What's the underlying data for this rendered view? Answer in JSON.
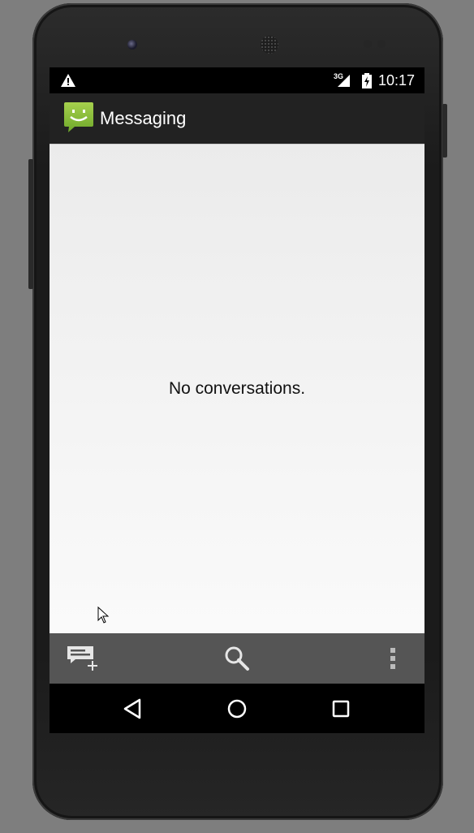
{
  "status_bar": {
    "warning_icon": "warning-icon",
    "network_type": "3G",
    "signal_icon": "cell-signal-icon",
    "battery_icon": "battery-charging-icon",
    "time": "10:17"
  },
  "action_bar": {
    "app_icon": "messaging-smiley-icon",
    "title": "Messaging",
    "background": "#222222",
    "accent": "#8dc63f"
  },
  "content": {
    "empty_message": "No conversations."
  },
  "bottom_bar": {
    "actions": [
      {
        "name": "new-message",
        "icon": "compose-icon"
      },
      {
        "name": "search",
        "icon": "search-icon"
      },
      {
        "name": "more-options",
        "icon": "overflow-menu-icon"
      }
    ],
    "background": "#555555"
  },
  "nav_bar": {
    "buttons": [
      {
        "name": "back",
        "icon": "back-triangle-icon"
      },
      {
        "name": "home",
        "icon": "home-circle-icon"
      },
      {
        "name": "recents",
        "icon": "recents-square-icon"
      }
    ]
  }
}
